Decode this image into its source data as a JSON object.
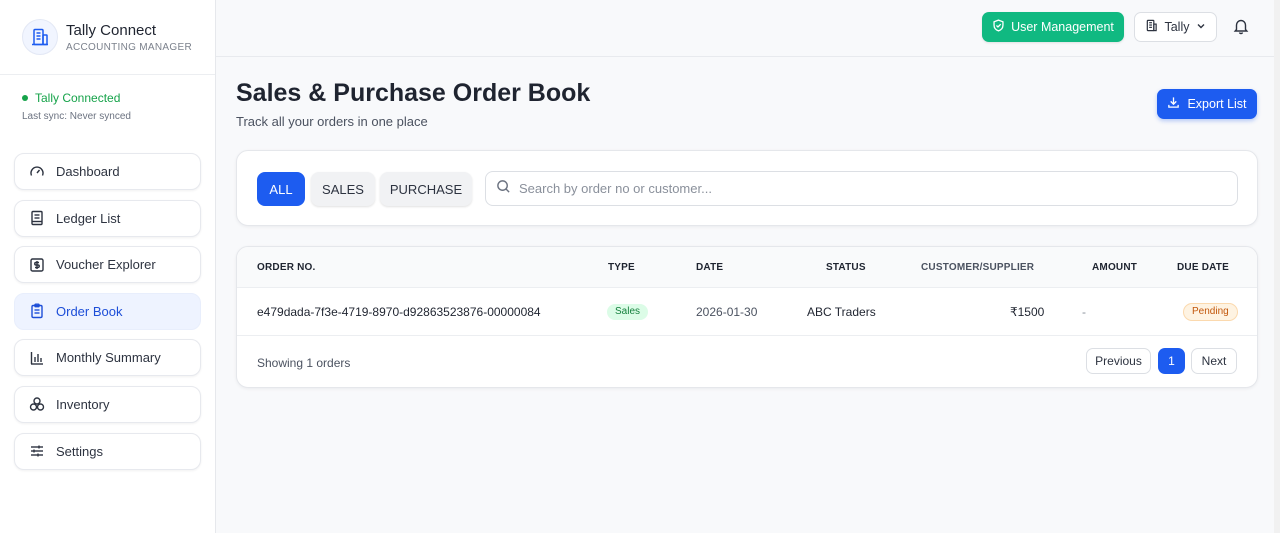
{
  "brand": {
    "title": "Tally Connect",
    "subtitle": "ACCOUNTING MANAGER",
    "logo_icon": "building-icon"
  },
  "connection": {
    "status": "Tally Connected",
    "last_sync": "Last sync: Never synced",
    "status_color": "#16a34a"
  },
  "sidebar": {
    "items": [
      {
        "label": "Dashboard",
        "icon": "gauge-icon",
        "active": false
      },
      {
        "label": "Ledger List",
        "icon": "book-icon",
        "active": false
      },
      {
        "label": "Voucher Explorer",
        "icon": "dollar-icon",
        "active": false
      },
      {
        "label": "Order Book",
        "icon": "clipboard-icon",
        "active": true
      },
      {
        "label": "Monthly Summary",
        "icon": "bar-chart-icon",
        "active": false
      },
      {
        "label": "Inventory",
        "icon": "boxes-icon",
        "active": false
      },
      {
        "label": "Settings",
        "icon": "sliders-icon",
        "active": false
      }
    ]
  },
  "topbar": {
    "user_management_label": "User Management",
    "company_label": "Tally",
    "accent_green": "#10b981"
  },
  "page": {
    "title": "Sales & Purchase Order Book",
    "subtitle": "Track all your orders in one place",
    "export_label": "Export List",
    "accent_blue": "#1d5cf0"
  },
  "filters": {
    "all": "ALL",
    "sales": "SALES",
    "purchase": "PURCHASE",
    "selected": "ALL",
    "search_placeholder": "Search by order no or customer..."
  },
  "table": {
    "headers": {
      "order_no": "ORDER NO.",
      "type": "TYPE",
      "date": "DATE",
      "status": "STATUS",
      "customer": "CUSTOMER/SUPPLIER",
      "amount": "AMOUNT",
      "due_date": "DUE DATE"
    },
    "rows": [
      {
        "order_no": "e479dada-7f3e-4719-8970-d92863523876-00000084",
        "type": "Sales",
        "date": "2026-01-30",
        "customer": "ABC Traders",
        "amount": "₹1500",
        "due": "-",
        "status": "Pending"
      }
    ],
    "footer": "Showing 1 orders"
  },
  "pagination": {
    "previous": "Previous",
    "current": "1",
    "next": "Next"
  }
}
